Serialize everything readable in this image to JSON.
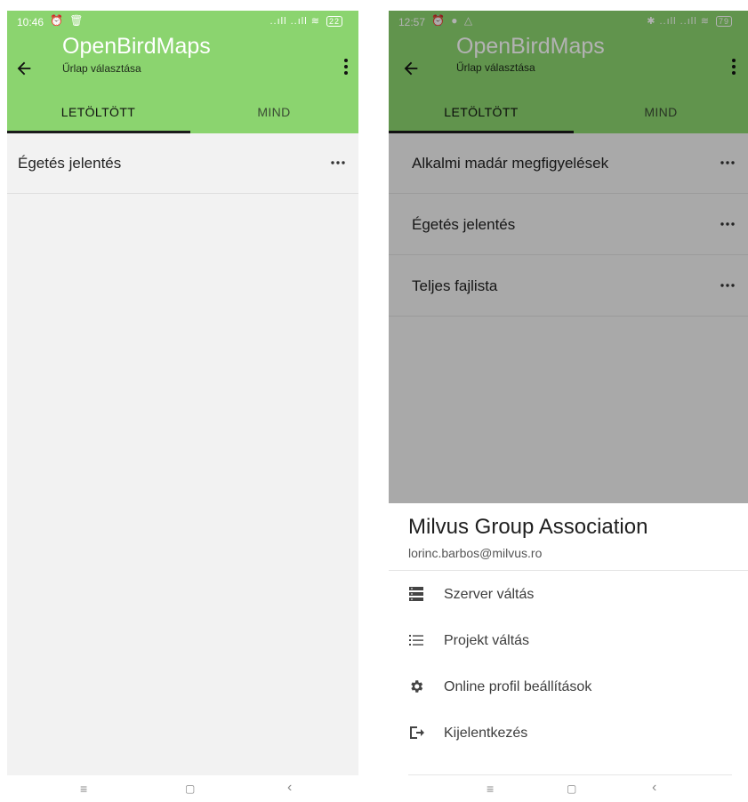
{
  "left_screen": {
    "status": {
      "time": "10:46",
      "left_icons": "⏰ 🗑",
      "signal": "..ıll ..ıll ≋",
      "battery": "22"
    },
    "app": {
      "title": "OpenBirdMaps",
      "subtitle": "Űrlap választása"
    },
    "tabs": [
      {
        "label": "LETÖLTÖTT",
        "active": true
      },
      {
        "label": "MIND",
        "active": false
      }
    ],
    "forms": [
      {
        "label": "Égetés jelentés"
      }
    ]
  },
  "right_screen": {
    "status": {
      "time": "12:57",
      "left_icons": "⏰ ● △",
      "signal": "✱ ..ıll ..ıll ≋",
      "battery": "79"
    },
    "app": {
      "title": "OpenBirdMaps",
      "subtitle": "Űrlap választása"
    },
    "tabs": [
      {
        "label": "LETÖLTÖTT",
        "active": true
      },
      {
        "label": "MIND",
        "active": false
      }
    ],
    "forms": [
      {
        "label": "Alkalmi madár megfigyelések"
      },
      {
        "label": "Égetés jelentés"
      },
      {
        "label": "Teljes fajlista"
      }
    ],
    "sheet": {
      "title": "Milvus Group Association",
      "email": "lorinc.barbos@milvus.ro",
      "items": [
        {
          "label": "Szerver váltás",
          "icon": "server-icon"
        },
        {
          "label": "Projekt váltás",
          "icon": "list-icon"
        },
        {
          "label": "Online profil beállítások",
          "icon": "settings-icon"
        },
        {
          "label": "Kijelentkezés",
          "icon": "logout-icon"
        }
      ]
    }
  },
  "nav": {
    "menu": "≡",
    "home": "▢",
    "back": "‹"
  },
  "colors": {
    "appbar": "#8bd46f",
    "background": "#f2f2f2",
    "tab_indicator": "#1b1b1b"
  }
}
